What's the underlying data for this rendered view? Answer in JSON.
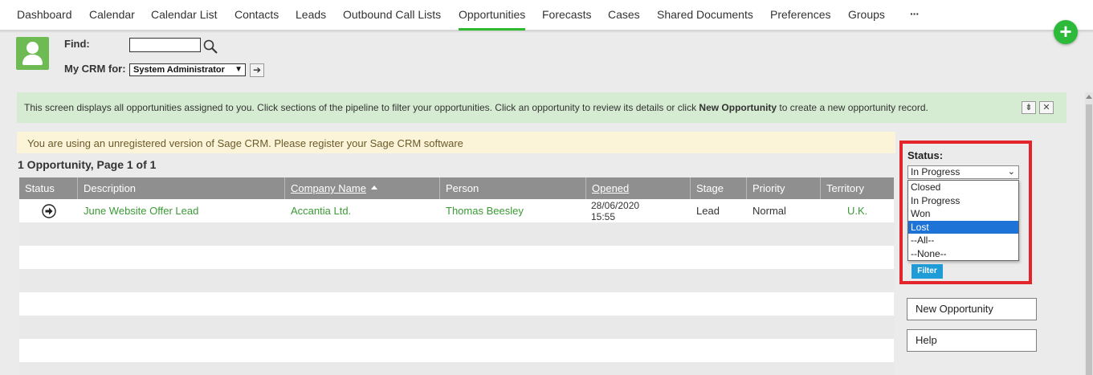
{
  "nav": {
    "items": [
      {
        "label": "Dashboard",
        "active": false
      },
      {
        "label": "Calendar",
        "active": false
      },
      {
        "label": "Calendar List",
        "active": false
      },
      {
        "label": "Contacts",
        "active": false
      },
      {
        "label": "Leads",
        "active": false
      },
      {
        "label": "Outbound Call Lists",
        "active": false
      },
      {
        "label": "Opportunities",
        "active": true
      },
      {
        "label": "Forecasts",
        "active": false
      },
      {
        "label": "Cases",
        "active": false
      },
      {
        "label": "Shared Documents",
        "active": false
      },
      {
        "label": "Preferences",
        "active": false
      },
      {
        "label": "Groups",
        "active": false
      }
    ],
    "more_label": "···",
    "accent_color": "#2eb82e"
  },
  "fab": {
    "label": "+",
    "icon": "plus-icon",
    "color": "#2db93a"
  },
  "header": {
    "find_label": "Find:",
    "find_value": "",
    "mycrm_label": "My CRM for:",
    "mycrm_value": "System Administrator",
    "go_label": "➔"
  },
  "info": {
    "text_before": "This screen displays all opportunities assigned to you. Click sections of the pipeline to filter your opportunities. Click an opportunity to review its details or click ",
    "text_bold": "New Opportunity",
    "text_after": " to create a new opportunity record.",
    "collapse_label": "⇟",
    "close_label": "✕"
  },
  "warning": {
    "text": "You are using an unregistered version of Sage CRM. Please register your Sage CRM software"
  },
  "list": {
    "title": "1 Opportunity, Page 1 of 1",
    "columns": [
      "Status",
      "Description",
      "Company Name",
      "Person",
      "Opened",
      "Stage",
      "Priority",
      "Territory"
    ],
    "rows": [
      {
        "status_icon": "arrow-circle-icon",
        "description": "June Website Offer Lead",
        "company": "Accantia Ltd.",
        "person": "Thomas Beesley",
        "opened_date": "28/06/2020",
        "opened_time": "15:55",
        "stage": "Lead",
        "priority": "Normal",
        "territory": "U.K."
      }
    ]
  },
  "filter": {
    "status_label": "Status:",
    "selected": "In Progress",
    "options": [
      "Closed",
      "In Progress",
      "Won",
      "Lost",
      "--All--",
      "--None--"
    ],
    "highlighted": "Lost",
    "button_label": "Filter",
    "highlight_color": "#e4242b"
  },
  "actions": {
    "new_opportunity": "New Opportunity",
    "help": "Help"
  }
}
